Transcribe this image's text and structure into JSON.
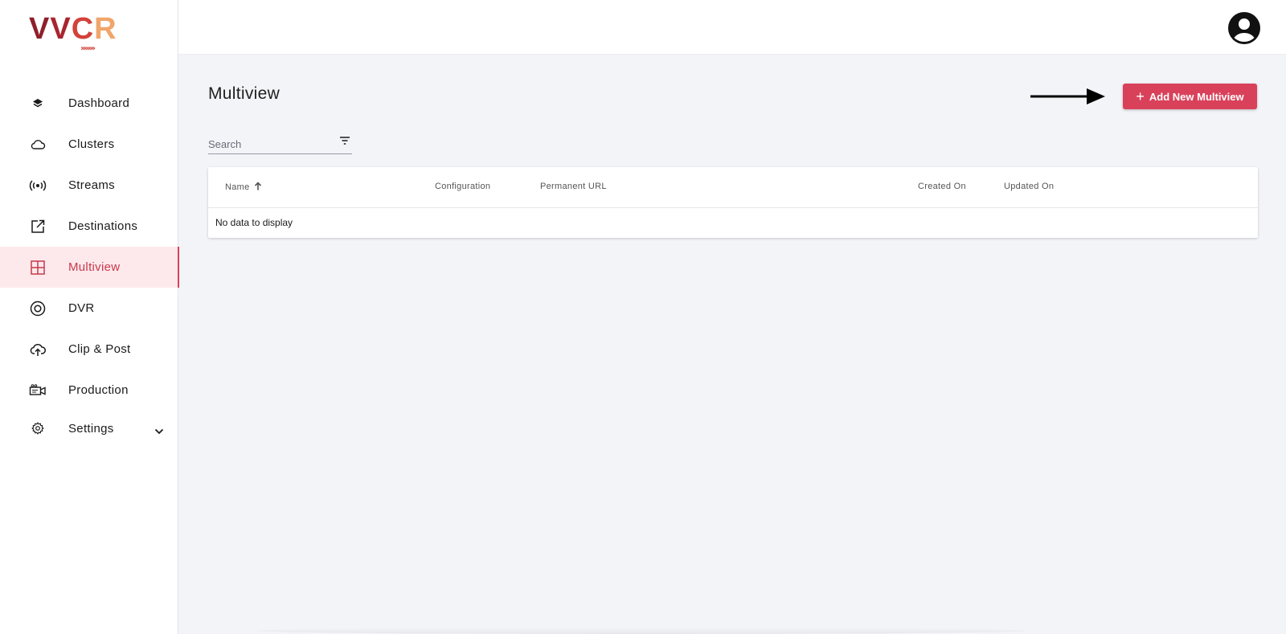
{
  "brand": {
    "logo_letters": [
      "V",
      "V",
      "C",
      "R"
    ],
    "logo_chevrons": "››››››››",
    "colors": [
      "#8e1f2b",
      "#a8252f",
      "#d3423a",
      "#f0a66a"
    ]
  },
  "sidebar": {
    "items": [
      {
        "label": "Dashboard",
        "icon": "layers-icon"
      },
      {
        "label": "Clusters",
        "icon": "cloud-icon"
      },
      {
        "label": "Streams",
        "icon": "broadcast-icon"
      },
      {
        "label": "Destinations",
        "icon": "external-link-icon"
      },
      {
        "label": "Multiview",
        "icon": "grid-icon",
        "active": true
      },
      {
        "label": "DVR",
        "icon": "record-icon"
      },
      {
        "label": "Clip & Post",
        "icon": "cloud-upload-icon"
      },
      {
        "label": "Production",
        "icon": "video-camera-icon"
      },
      {
        "label": "Settings",
        "icon": "gear-icon",
        "expandable": true
      }
    ],
    "accent": "#d9415a",
    "active_bg": "#fde9ec"
  },
  "header": {
    "avatar_icon": "user-avatar-icon"
  },
  "main": {
    "title": "Multiview",
    "add_button_label": "Add New Multiview",
    "search_placeholder": "Search",
    "table": {
      "columns": [
        "Name",
        "Configuration",
        "Permanent URL",
        "Created On",
        "Updated On"
      ],
      "sorted_column": "Name",
      "sort_direction": "ascending",
      "empty_message": "No data to display"
    }
  }
}
